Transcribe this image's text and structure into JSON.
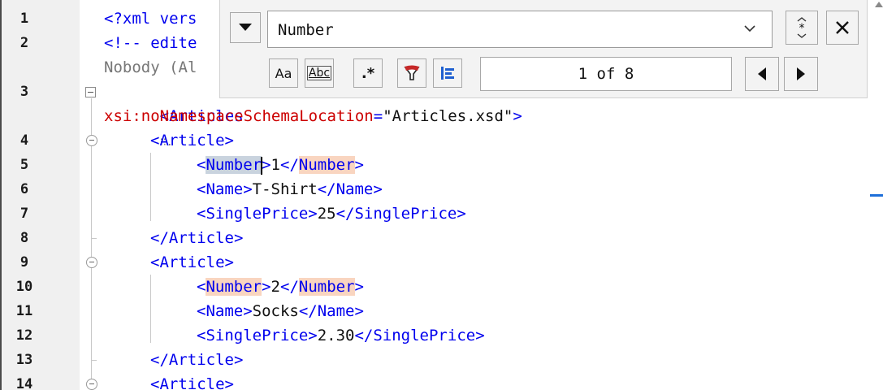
{
  "find_panel": {
    "search_value": "Number",
    "search_placeholder": "",
    "match_counter": "1 of 8",
    "options": {
      "match_case_label": "Aa",
      "whole_word_label": "Abc",
      "regex_label": ".*"
    },
    "icons": {
      "toggle": "triangle-down-icon",
      "dropdown": "chevron-down-icon",
      "find_all": "asterisk-arrows-icon",
      "close": "close-icon",
      "find_in_selection": "filter-icon",
      "bookmark": "align-left-icon",
      "previous": "triangle-left-icon",
      "next": "triangle-right-icon"
    },
    "colors": {
      "highlight": "#f9d5c0",
      "current_match": "#c9d3de",
      "scroll_marker": "#1e6fd9"
    }
  },
  "editor": {
    "line_numbers": [
      "1",
      "2",
      "",
      "3",
      "",
      "4",
      "5",
      "6",
      "7",
      "8",
      "9",
      "10",
      "11",
      "12",
      "13",
      "14"
    ],
    "lines": {
      "l1": "<?xml vers",
      "l2": "<!-- edite",
      "l2b": "Nobody (Al",
      "l3_tag": "<Articles",
      "l3_more": "⁝⁝.",
      "l3b_attr": "xsi:noNamespaceSchemaLocation",
      "l3b_eq": "=",
      "l3b_val": "\"Articles.xsd\"",
      "l3b_close": ">",
      "article_open": "<Article>",
      "article_close": "</Article>",
      "lt": "<",
      "gt": ">",
      "lt_slash": "</",
      "number_tag": "Number",
      "name_open": "<Name>",
      "name_close": "</Name>",
      "price_open": "<SinglePrice>",
      "price_close": "</SinglePrice>",
      "v5": "1",
      "v6": "T-Shirt",
      "v7": "25",
      "v10": "2",
      "v11": "Socks",
      "v12": "2.30"
    }
  }
}
